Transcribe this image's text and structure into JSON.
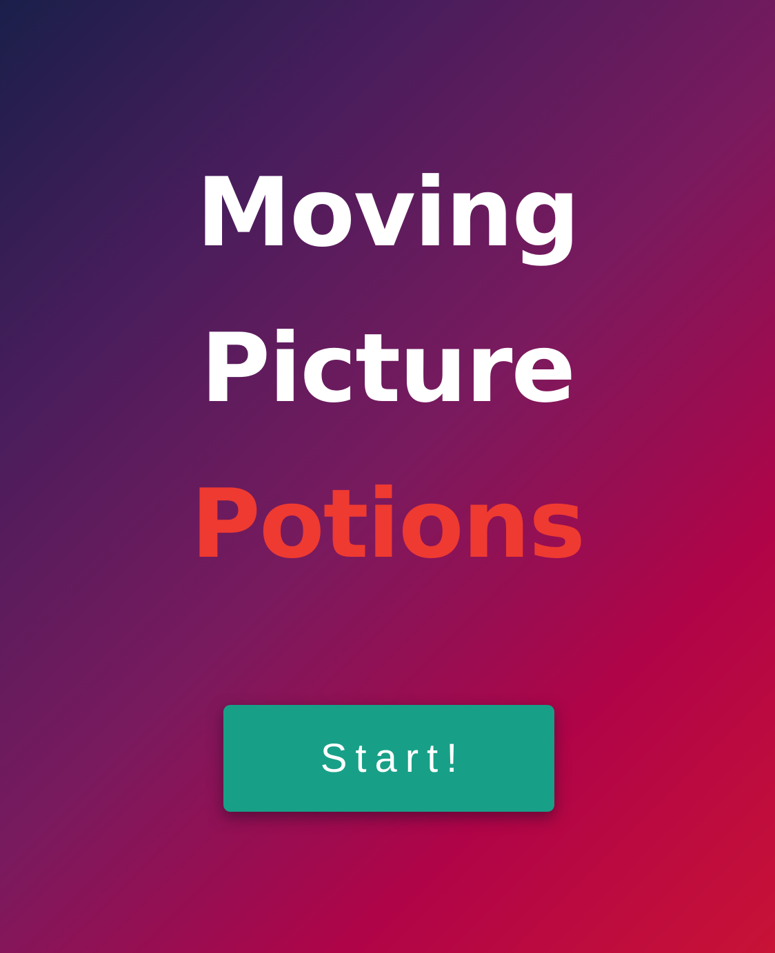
{
  "title": {
    "line1": "Moving",
    "line2": "Picture",
    "line3": "Potions"
  },
  "start_button": {
    "label": "Start!"
  },
  "colors": {
    "title_primary": "#ffffff",
    "title_accent": "#ee3a31",
    "button_bg": "#17a087",
    "background_start": "#1a1f4a",
    "background_end": "#c81236"
  }
}
